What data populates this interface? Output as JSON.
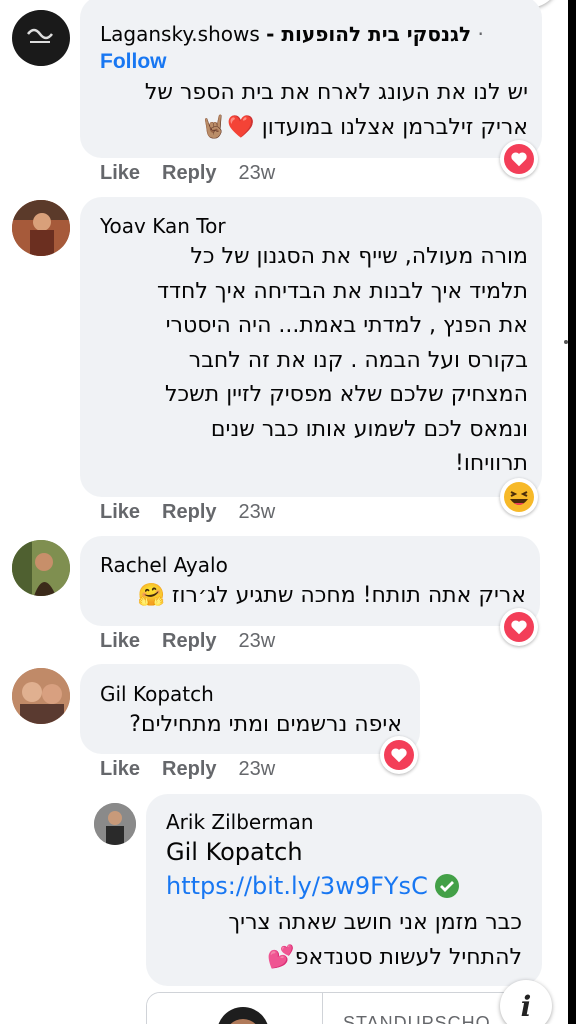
{
  "comments": [
    {
      "author": "Lagansky.shows",
      "author_suffix": "- לגנסקי בית להופעות",
      "follow_label": "Follow",
      "text_lines": [
        "יש לנו את העונג לארח את בית הספר של",
        "אריק זילברמן אצלנו במועדון"
      ],
      "trailing_emoji": "❤️🤘🏽",
      "reaction": "heart",
      "like": "Like",
      "reply": "Reply",
      "time": "23w"
    },
    {
      "author": "Yoav Kan Tor",
      "text_lines": [
        "מורה מעולה, שייף את הסגנון של כל",
        "תלמיד איך לבנות את הבדיחה איך לחדד",
        "את הפנץ , למדתי באמת... היה היסטרי",
        "בקורס ועל הבמה . קנו את זה לחבר",
        "המצחיק שלכם שלא מפסיק לזיין תשכל",
        "ונמאס לכם לשמוע אותו כבר שנים",
        "תרוויחו!"
      ],
      "reaction": "haha",
      "like": "Like",
      "reply": "Reply",
      "time": "23w"
    },
    {
      "author": "Rachel Ayalo",
      "text_lines": [
        "אריק אתה תותח! מחכה שתגיע לג׳רוז 🤗"
      ],
      "reaction": "heart",
      "like": "Like",
      "reply": "Reply",
      "time": "23w"
    },
    {
      "author": "Gil Kopatch",
      "text_lines": [
        "איפה נרשמים ומתי מתחילים?"
      ],
      "reaction": "heart",
      "like": "Like",
      "reply": "Reply",
      "time": "23w"
    }
  ],
  "reply": {
    "author": "Arik Zilberman",
    "mention": "Gil Kopatch",
    "link": "https://bit.ly/3w9FYsC",
    "text_lines": [
      "כבר מזמן אני חושב שאתה צריך",
      "להתחיל לעשות סטנדאפ"
    ],
    "trailing_emoji": "💕"
  },
  "preview": {
    "label": "STANDUPSCHO"
  },
  "info_glyph": "i",
  "colors": {
    "bubble": "#f0f2f5",
    "link": "#1877f2",
    "heart": "#f33e58",
    "muted": "#65676b"
  }
}
